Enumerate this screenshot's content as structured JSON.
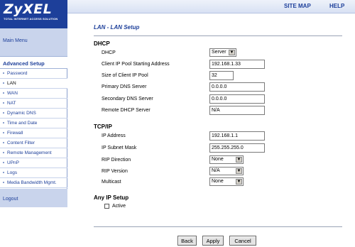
{
  "brand": {
    "logo": "ZyXEL",
    "tagline": "TOTAL INTERNET ACCESS SOLUTION",
    "color": "#1d3f9a"
  },
  "top_links": {
    "site_map": "SITE MAP",
    "help": "HELP"
  },
  "sidebar": {
    "main_menu": "Main Menu",
    "advanced_setup": "Advanced Setup",
    "items": [
      {
        "label": "Password"
      },
      {
        "label": "LAN"
      },
      {
        "label": "WAN"
      },
      {
        "label": "NAT"
      },
      {
        "label": "Dynamic DNS"
      },
      {
        "label": "Time and Date"
      },
      {
        "label": "Firewall"
      },
      {
        "label": "Content Filter"
      },
      {
        "label": "Remote Management"
      },
      {
        "label": "UPnP"
      },
      {
        "label": "Logs"
      },
      {
        "label": "Media Bandwidth Mgmt."
      }
    ],
    "logout": "Logout"
  },
  "page": {
    "title": "LAN - LAN Setup"
  },
  "dhcp": {
    "heading": "DHCP",
    "fields": {
      "dhcp_label": "DHCP",
      "dhcp_value": "Server",
      "pool_start_label": "Client IP Pool Starting Address",
      "pool_start_value": "192.168.1.33",
      "pool_size_label": "Size of Client IP Pool",
      "pool_size_value": "32",
      "primary_dns_label": "Primary DNS Server",
      "primary_dns_value": "0.0.0.0",
      "secondary_dns_label": "Secondary DNS Server",
      "secondary_dns_value": "0.0.0.0",
      "remote_dhcp_label": "Remote DHCP Server",
      "remote_dhcp_value": "N/A"
    }
  },
  "tcpip": {
    "heading": "TCP/IP",
    "fields": {
      "ip_label": "IP Address",
      "ip_value": "192.168.1.1",
      "mask_label": "IP Subnet Mask",
      "mask_value": "255.255.255.0",
      "rip_dir_label": "RIP Direction",
      "rip_dir_value": "None",
      "rip_ver_label": "RIP Version",
      "rip_ver_value": "N/A",
      "multicast_label": "Multicast",
      "multicast_value": "None"
    }
  },
  "any_ip": {
    "heading": "Any IP Setup",
    "active_label": "Active",
    "active_checked": false
  },
  "buttons": {
    "back": "Back",
    "apply": "Apply",
    "cancel": "Cancel"
  }
}
